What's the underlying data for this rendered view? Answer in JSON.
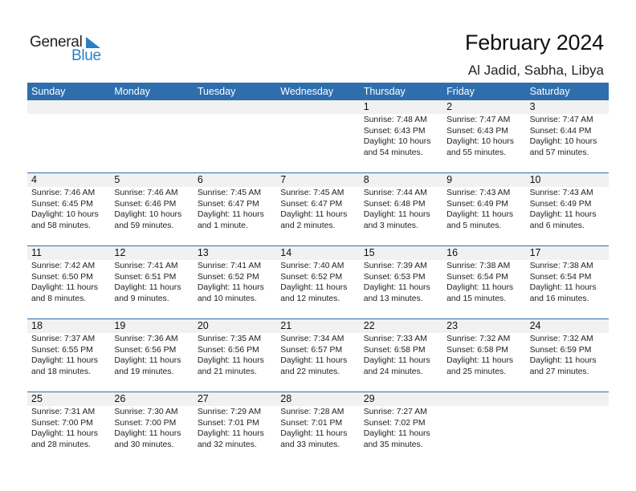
{
  "brand": {
    "word1": "General",
    "word2": "Blue",
    "icon": "triangle-logo-icon",
    "accent": "#2a7fc1"
  },
  "header": {
    "title": "February 2024",
    "location": "Al Jadid, Sabha, Libya"
  },
  "colors": {
    "header_bg": "#2e6ead",
    "date_strip_bg": "#f1f1f1"
  },
  "weekdays": [
    "Sunday",
    "Monday",
    "Tuesday",
    "Wednesday",
    "Thursday",
    "Friday",
    "Saturday"
  ],
  "weeks": [
    [
      null,
      null,
      null,
      null,
      {
        "day": "1",
        "sunrise": "Sunrise: 7:48 AM",
        "sunset": "Sunset: 6:43 PM",
        "daylight1": "Daylight: 10 hours",
        "daylight2": "and 54 minutes."
      },
      {
        "day": "2",
        "sunrise": "Sunrise: 7:47 AM",
        "sunset": "Sunset: 6:43 PM",
        "daylight1": "Daylight: 10 hours",
        "daylight2": "and 55 minutes."
      },
      {
        "day": "3",
        "sunrise": "Sunrise: 7:47 AM",
        "sunset": "Sunset: 6:44 PM",
        "daylight1": "Daylight: 10 hours",
        "daylight2": "and 57 minutes."
      }
    ],
    [
      {
        "day": "4",
        "sunrise": "Sunrise: 7:46 AM",
        "sunset": "Sunset: 6:45 PM",
        "daylight1": "Daylight: 10 hours",
        "daylight2": "and 58 minutes."
      },
      {
        "day": "5",
        "sunrise": "Sunrise: 7:46 AM",
        "sunset": "Sunset: 6:46 PM",
        "daylight1": "Daylight: 10 hours",
        "daylight2": "and 59 minutes."
      },
      {
        "day": "6",
        "sunrise": "Sunrise: 7:45 AM",
        "sunset": "Sunset: 6:47 PM",
        "daylight1": "Daylight: 11 hours",
        "daylight2": "and 1 minute."
      },
      {
        "day": "7",
        "sunrise": "Sunrise: 7:45 AM",
        "sunset": "Sunset: 6:47 PM",
        "daylight1": "Daylight: 11 hours",
        "daylight2": "and 2 minutes."
      },
      {
        "day": "8",
        "sunrise": "Sunrise: 7:44 AM",
        "sunset": "Sunset: 6:48 PM",
        "daylight1": "Daylight: 11 hours",
        "daylight2": "and 3 minutes."
      },
      {
        "day": "9",
        "sunrise": "Sunrise: 7:43 AM",
        "sunset": "Sunset: 6:49 PM",
        "daylight1": "Daylight: 11 hours",
        "daylight2": "and 5 minutes."
      },
      {
        "day": "10",
        "sunrise": "Sunrise: 7:43 AM",
        "sunset": "Sunset: 6:49 PM",
        "daylight1": "Daylight: 11 hours",
        "daylight2": "and 6 minutes."
      }
    ],
    [
      {
        "day": "11",
        "sunrise": "Sunrise: 7:42 AM",
        "sunset": "Sunset: 6:50 PM",
        "daylight1": "Daylight: 11 hours",
        "daylight2": "and 8 minutes."
      },
      {
        "day": "12",
        "sunrise": "Sunrise: 7:41 AM",
        "sunset": "Sunset: 6:51 PM",
        "daylight1": "Daylight: 11 hours",
        "daylight2": "and 9 minutes."
      },
      {
        "day": "13",
        "sunrise": "Sunrise: 7:41 AM",
        "sunset": "Sunset: 6:52 PM",
        "daylight1": "Daylight: 11 hours",
        "daylight2": "and 10 minutes."
      },
      {
        "day": "14",
        "sunrise": "Sunrise: 7:40 AM",
        "sunset": "Sunset: 6:52 PM",
        "daylight1": "Daylight: 11 hours",
        "daylight2": "and 12 minutes."
      },
      {
        "day": "15",
        "sunrise": "Sunrise: 7:39 AM",
        "sunset": "Sunset: 6:53 PM",
        "daylight1": "Daylight: 11 hours",
        "daylight2": "and 13 minutes."
      },
      {
        "day": "16",
        "sunrise": "Sunrise: 7:38 AM",
        "sunset": "Sunset: 6:54 PM",
        "daylight1": "Daylight: 11 hours",
        "daylight2": "and 15 minutes."
      },
      {
        "day": "17",
        "sunrise": "Sunrise: 7:38 AM",
        "sunset": "Sunset: 6:54 PM",
        "daylight1": "Daylight: 11 hours",
        "daylight2": "and 16 minutes."
      }
    ],
    [
      {
        "day": "18",
        "sunrise": "Sunrise: 7:37 AM",
        "sunset": "Sunset: 6:55 PM",
        "daylight1": "Daylight: 11 hours",
        "daylight2": "and 18 minutes."
      },
      {
        "day": "19",
        "sunrise": "Sunrise: 7:36 AM",
        "sunset": "Sunset: 6:56 PM",
        "daylight1": "Daylight: 11 hours",
        "daylight2": "and 19 minutes."
      },
      {
        "day": "20",
        "sunrise": "Sunrise: 7:35 AM",
        "sunset": "Sunset: 6:56 PM",
        "daylight1": "Daylight: 11 hours",
        "daylight2": "and 21 minutes."
      },
      {
        "day": "21",
        "sunrise": "Sunrise: 7:34 AM",
        "sunset": "Sunset: 6:57 PM",
        "daylight1": "Daylight: 11 hours",
        "daylight2": "and 22 minutes."
      },
      {
        "day": "22",
        "sunrise": "Sunrise: 7:33 AM",
        "sunset": "Sunset: 6:58 PM",
        "daylight1": "Daylight: 11 hours",
        "daylight2": "and 24 minutes."
      },
      {
        "day": "23",
        "sunrise": "Sunrise: 7:32 AM",
        "sunset": "Sunset: 6:58 PM",
        "daylight1": "Daylight: 11 hours",
        "daylight2": "and 25 minutes."
      },
      {
        "day": "24",
        "sunrise": "Sunrise: 7:32 AM",
        "sunset": "Sunset: 6:59 PM",
        "daylight1": "Daylight: 11 hours",
        "daylight2": "and 27 minutes."
      }
    ],
    [
      {
        "day": "25",
        "sunrise": "Sunrise: 7:31 AM",
        "sunset": "Sunset: 7:00 PM",
        "daylight1": "Daylight: 11 hours",
        "daylight2": "and 28 minutes."
      },
      {
        "day": "26",
        "sunrise": "Sunrise: 7:30 AM",
        "sunset": "Sunset: 7:00 PM",
        "daylight1": "Daylight: 11 hours",
        "daylight2": "and 30 minutes."
      },
      {
        "day": "27",
        "sunrise": "Sunrise: 7:29 AM",
        "sunset": "Sunset: 7:01 PM",
        "daylight1": "Daylight: 11 hours",
        "daylight2": "and 32 minutes."
      },
      {
        "day": "28",
        "sunrise": "Sunrise: 7:28 AM",
        "sunset": "Sunset: 7:01 PM",
        "daylight1": "Daylight: 11 hours",
        "daylight2": "and 33 minutes."
      },
      {
        "day": "29",
        "sunrise": "Sunrise: 7:27 AM",
        "sunset": "Sunset: 7:02 PM",
        "daylight1": "Daylight: 11 hours",
        "daylight2": "and 35 minutes."
      },
      null,
      null
    ]
  ]
}
